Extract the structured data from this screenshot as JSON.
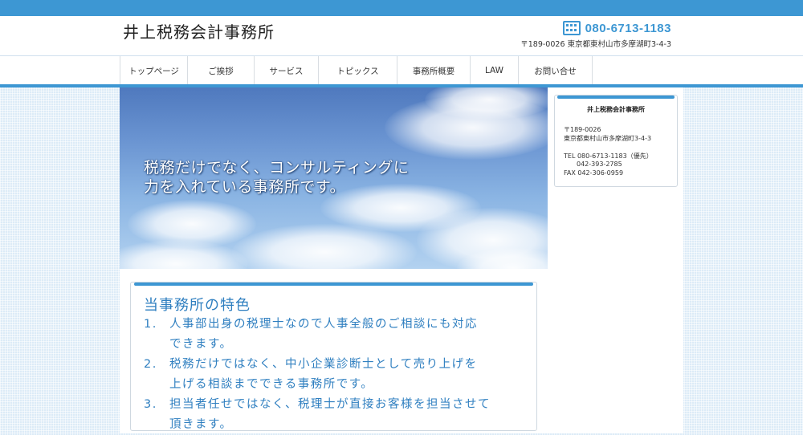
{
  "header": {
    "site_title": "井上税務会計事務所",
    "phone": "080-6713-1183",
    "address": "〒189-0026 東京都東村山市多摩湖町3-4-3"
  },
  "nav": {
    "items": [
      {
        "label": "トップページ"
      },
      {
        "label": "ご挨拶"
      },
      {
        "label": "サービス"
      },
      {
        "label": "トピックス"
      },
      {
        "label": "事務所概要"
      },
      {
        "label": "LAW"
      },
      {
        "label": "お問い合せ"
      }
    ]
  },
  "hero": {
    "line1": "税務だけでなく、コンサルティングに",
    "line2": "力を入れている事務所です。"
  },
  "features": {
    "title": "当事務所の特色",
    "items": [
      {
        "num": "1.",
        "line1": "人事部出身の税理士なので人事全般のご相談にも対応",
        "line2": "できます。"
      },
      {
        "num": "2.",
        "line1": "税務だけではなく、中小企業診断士として売り上げを",
        "line2": "上げる相談までできる事務所です。"
      },
      {
        "num": "3.",
        "line1": "担当者任せではなく、税理士が直接お客様を担当させて",
        "line2": "頂きます。"
      }
    ]
  },
  "sidebar": {
    "title": "井上税務会計事務所",
    "postal": "〒189-0026",
    "address": "東京都東村山市多摩湖町3-4-3",
    "tel": "TEL 080-6713-1183（優先）",
    "tel2": "042-393-2785",
    "fax": "FAX 042-306-0959"
  },
  "colors": {
    "accent": "#3d97d3",
    "text_blue": "#2f7fc0"
  },
  "icons": {
    "phone": "building-phone-icon"
  }
}
